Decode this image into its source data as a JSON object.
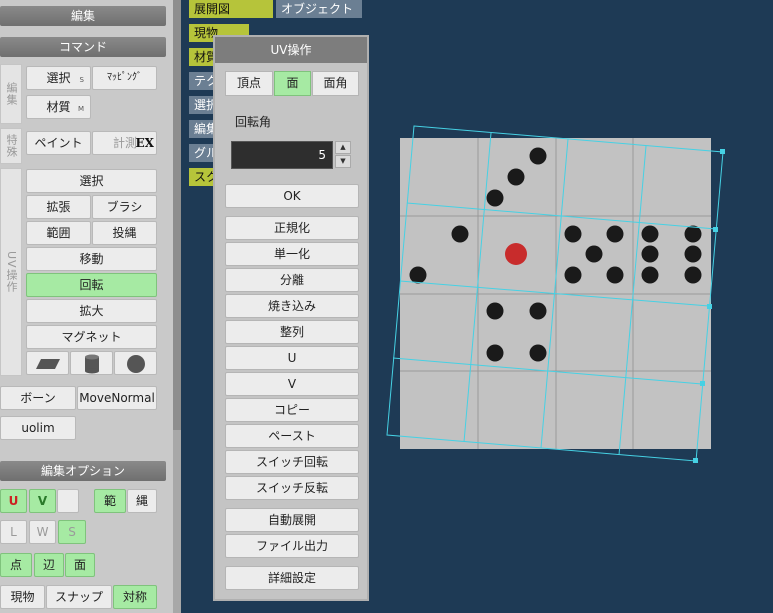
{
  "left": {
    "edit_header": "編集",
    "command_header": "コマンド",
    "edit_side": "編集",
    "special_side": "特殊",
    "uv_side": "UV操作",
    "select": "選択",
    "select_key": "S",
    "mapping": "ﾏｯﾋﾟﾝｸﾞ",
    "material": "材質",
    "material_key": "M",
    "paint": "ペイント",
    "measure": "計測",
    "ex": "EX",
    "uv_buttons": {
      "select": "選択",
      "expand": "拡張",
      "brush": "ブラシ",
      "range": "範囲",
      "lasso": "投縄",
      "move": "移動",
      "rotate": "回転",
      "scale": "拡大",
      "magnet": "マグネット"
    },
    "bone": "ボーン",
    "move_normal": "MoveNormal",
    "uolim": "uolim",
    "edit_options_header": "編集オプション",
    "opt_u": "U",
    "opt_v": "V",
    "opt_range": "範",
    "opt_rope": "縄",
    "opt_l": "L",
    "opt_w": "W",
    "opt_s": "S",
    "opt_point": "点",
    "opt_edge": "辺",
    "opt_face": "面",
    "opt_current": "現物",
    "opt_snap": "スナップ",
    "opt_symmetry": "対称"
  },
  "tabs": {
    "unfold": "展開図",
    "object": "オブジェクト",
    "current": "現物",
    "material": "材質",
    "texture": "テクスチャ",
    "select": "選択",
    "edit": "編集",
    "group": "グループ",
    "script": "スクリプト"
  },
  "dialog": {
    "title": "UV操作",
    "seg_vertex": "頂点",
    "seg_face": "面",
    "seg_facecorner": "面角",
    "rotation_label": "回転角",
    "rotation_value": "5",
    "ok": "OK",
    "buttons": [
      "正規化",
      "単一化",
      "分離",
      "焼き込み",
      "整列",
      "U",
      "V",
      "コピー",
      "ペースト",
      "スイッチ回転",
      "スイッチ反転"
    ],
    "auto_unfold": "自動展開",
    "file_output": "ファイル出力",
    "detail_settings": "詳細設定"
  },
  "colors": {
    "background": "#1e3a55",
    "accent_green": "#a6eaa3",
    "uv_line": "#46d1e4",
    "dot": "#1a1a1a",
    "red_dot": "#c82c2c"
  }
}
